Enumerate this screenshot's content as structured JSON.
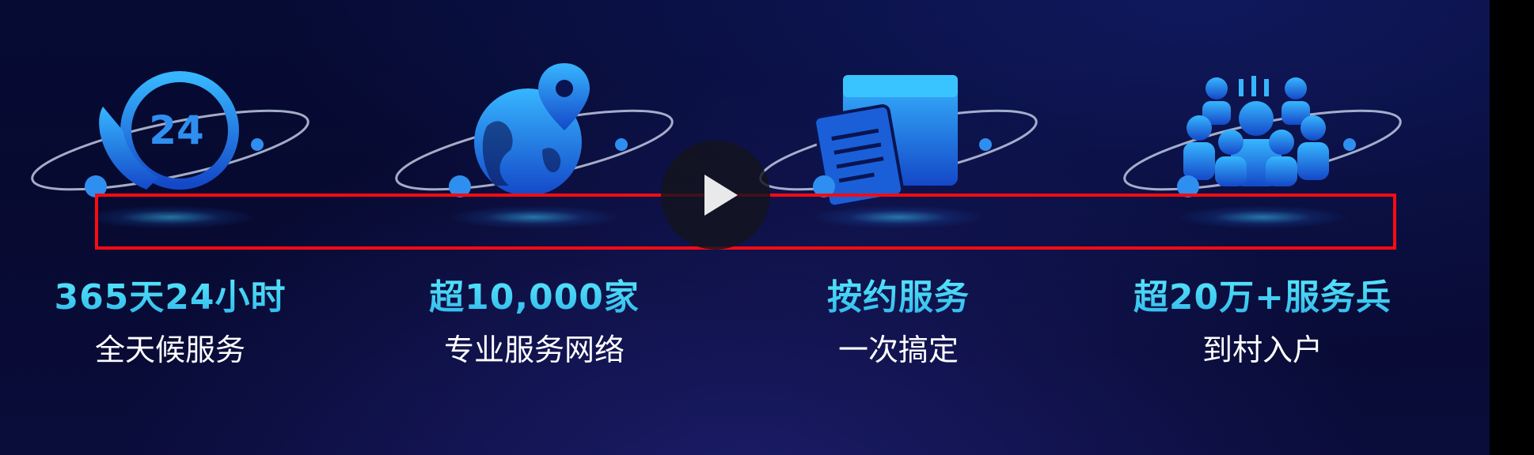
{
  "features": [
    {
      "icon": "24-hour-phone-icon",
      "headline": "365天24小时",
      "subline": "全天候服务"
    },
    {
      "icon": "globe-location-icon",
      "headline": "超10,000家",
      "subline": "专业服务网络"
    },
    {
      "icon": "clipboard-box-icon",
      "headline": "按约服务",
      "subline": "一次搞定"
    },
    {
      "icon": "service-team-icon",
      "headline": "超20万+服务兵",
      "subline": "到村入户"
    }
  ],
  "icon_badge_text": "24",
  "colors": {
    "headline": "#3fd8f3",
    "subline": "#ffffff",
    "icon_blue": "#1e7be8",
    "highlight_box": "#ff0a12",
    "background": "#070a30"
  },
  "player": {
    "play_icon": "play-icon"
  }
}
